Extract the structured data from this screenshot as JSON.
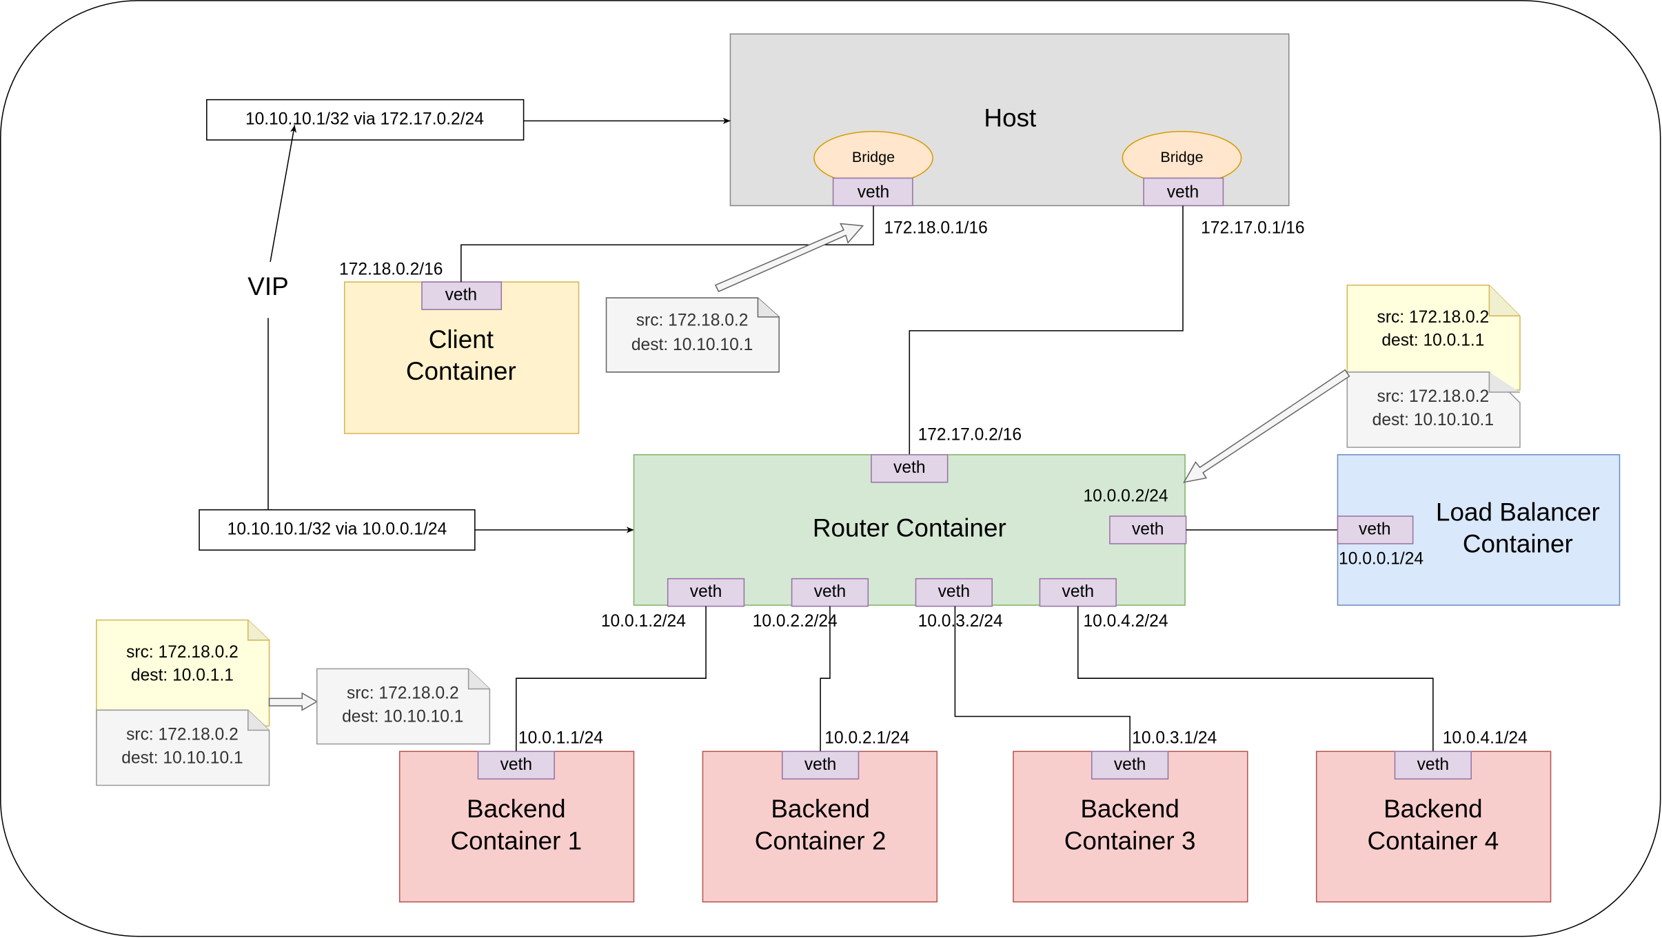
{
  "host": {
    "title": "Host",
    "bridge_left": "Bridge",
    "bridge_right": "Bridge",
    "veth_left": "veth",
    "veth_right": "veth",
    "ip_left": "172.18.0.1/16",
    "ip_right": "172.17.0.1/16"
  },
  "routes": {
    "host_route": "10.10.10.1/32 via 172.17.0.2/24",
    "router_route": "10.10.10.1/32 via 10.0.0.1/24",
    "vip_label": "VIP"
  },
  "client": {
    "title_line1": "Client",
    "title_line2": "Container",
    "veth": "veth",
    "ip": "172.18.0.2/16"
  },
  "router": {
    "title": "Router Container",
    "veth_top": "veth",
    "ip_top": "172.17.0.2/16",
    "veth_right": "veth",
    "ip_right": "10.0.0.2/24",
    "bottom_ports": [
      {
        "veth": "veth",
        "ip": "10.0.1.2/24"
      },
      {
        "veth": "veth",
        "ip": "10.0.2.2/24"
      },
      {
        "veth": "veth",
        "ip": "10.0.3.2/24"
      },
      {
        "veth": "veth",
        "ip": "10.0.4.2/24"
      }
    ]
  },
  "load_balancer": {
    "title_line1": "Load Balancer",
    "title_line2": "Container",
    "veth": "veth",
    "ip": "10.0.0.1/24"
  },
  "backends": [
    {
      "line1": "Backend",
      "line2": "Container 1",
      "veth": "veth",
      "ip": "10.0.1.1/24"
    },
    {
      "line1": "Backend",
      "line2": "Container 2",
      "veth": "veth",
      "ip": "10.0.2.1/24"
    },
    {
      "line1": "Backend",
      "line2": "Container 3",
      "veth": "veth",
      "ip": "10.0.3.1/24"
    },
    {
      "line1": "Backend",
      "line2": "Container 4",
      "veth": "veth",
      "ip": "10.0.4.1/24"
    }
  ],
  "packets": {
    "client_out": {
      "src": "src: 172.18.0.2",
      "dest": "dest: 10.10.10.1"
    },
    "lb_rewritten": {
      "src": "src: 172.18.0.2",
      "dest": "dest: 10.0.1.1"
    },
    "lb_original": {
      "src": "src: 172.18.0.2",
      "dest": "dest: 10.10.10.1"
    },
    "backend_rewritten": {
      "src": "src: 172.18.0.2",
      "dest": "dest: 10.0.1.1"
    },
    "backend_original": {
      "src": "src: 172.18.0.2",
      "dest": "dest: 10.10.10.1"
    },
    "backend_reply": {
      "src": "src: 172.18.0.2",
      "dest": "dest: 10.10.10.1"
    }
  },
  "colors": {
    "host": "#e0e0e0",
    "bridge": "#ffe6cc",
    "veth": "#e1d5e7",
    "client": "#fff2cc",
    "router": "#d5e8d4",
    "load_balancer": "#dae8fc",
    "backend": "#f8cecc",
    "note_yellow": "#ffffdd",
    "note_gray": "#f5f5f5"
  }
}
